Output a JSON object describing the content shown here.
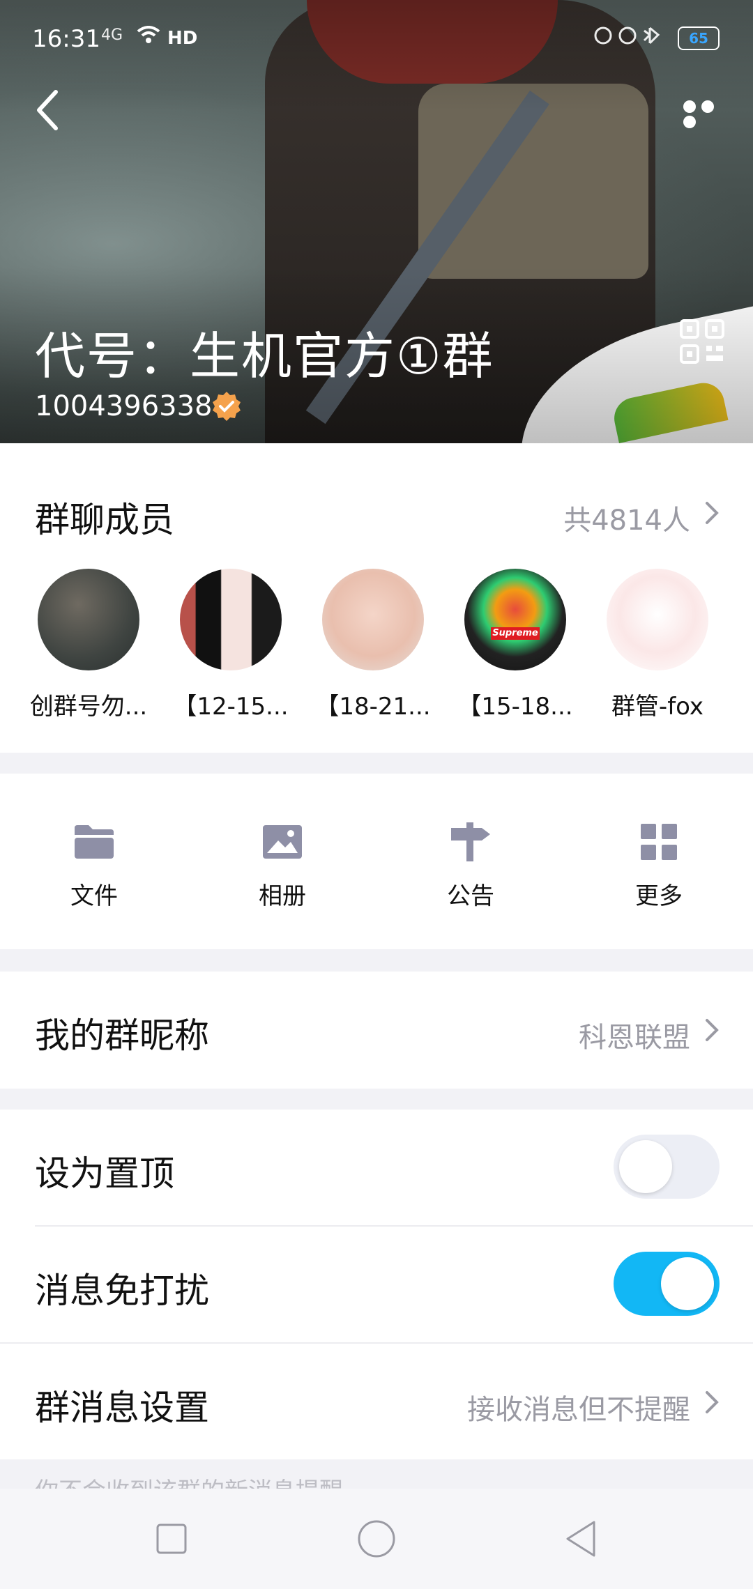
{
  "status_bar": {
    "time": "16:31",
    "network": "4G",
    "hd": "HD",
    "battery": "65"
  },
  "header": {
    "group_name": "代号：生机官方①群",
    "group_id": "1004396338",
    "icons": [
      "back-arrow-icon",
      "more-options-icon",
      "verified-badge-icon",
      "qr-code-icon"
    ]
  },
  "members": {
    "title": "群聊成员",
    "count": "共4814人",
    "list": [
      {
        "name": "创群号勿..."
      },
      {
        "name": "【12-15..."
      },
      {
        "name": "【18-21..."
      },
      {
        "name": "【15-18..."
      },
      {
        "name": "群管-fox"
      }
    ],
    "avatar_text": "Supreme"
  },
  "tools": [
    {
      "label": "文件",
      "icon": "folder-icon"
    },
    {
      "label": "相册",
      "icon": "image-icon"
    },
    {
      "label": "公告",
      "icon": "signpost-icon"
    },
    {
      "label": "更多",
      "icon": "grid-icon"
    }
  ],
  "nickname": {
    "label": "我的群昵称",
    "value": "科恩联盟"
  },
  "settings": {
    "pin": {
      "label": "设为置顶",
      "on": false
    },
    "mute": {
      "label": "消息免打扰",
      "on": true
    },
    "message_settings": {
      "label": "群消息设置",
      "value": "接收消息但不提醒"
    }
  },
  "footer_hint": "你不会收到该群的新消息提醒",
  "colors": {
    "accent": "#12b7f5",
    "toggle_off": "#eceef5",
    "muted_text": "#9a9aa3",
    "icon_gray": "#8e8fa6"
  },
  "navbar": [
    "square-icon",
    "circle-icon",
    "triangle-back-icon"
  ]
}
